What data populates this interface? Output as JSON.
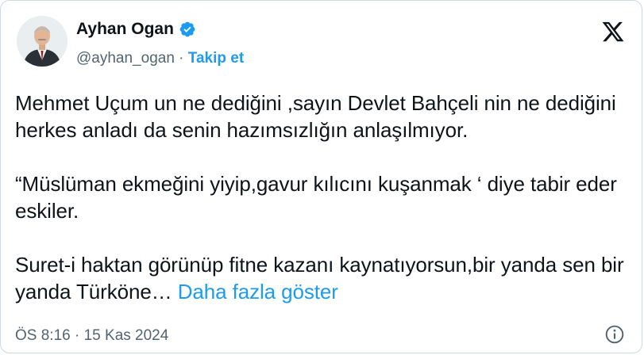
{
  "author": {
    "name": "Ayhan Ogan",
    "handle": "@ayhan_ogan",
    "separator": "·",
    "follow_label": "Takip et",
    "verified": true
  },
  "icons": {
    "verified": "verified-badge-icon",
    "brand": "x-logo-icon",
    "info": "info-icon"
  },
  "colors": {
    "accent": "#1d9bf0",
    "secondary_text": "#536471",
    "primary_text": "#0f1419"
  },
  "tweet": {
    "paragraphs": [
      "Mehmet Uçum un ne dediğini ,sayın Devlet Bahçeli nin ne dediğini herkes anladı da senin hazımsızlığın anlaşılmıyor.",
      "“Müslüman ekmeğini yiyip,gavur kılıcını kuşanmak ‘ diye tabir eder eskiler.",
      "Suret-i haktan görünüp fitne kazanı kaynatıyorsun,bir yanda sen bir yanda Türköne…"
    ],
    "show_more": "Daha fazla göster"
  },
  "meta": {
    "time": "ÖS 8:16",
    "date_separator": "·",
    "date": "15 Kas 2024"
  }
}
